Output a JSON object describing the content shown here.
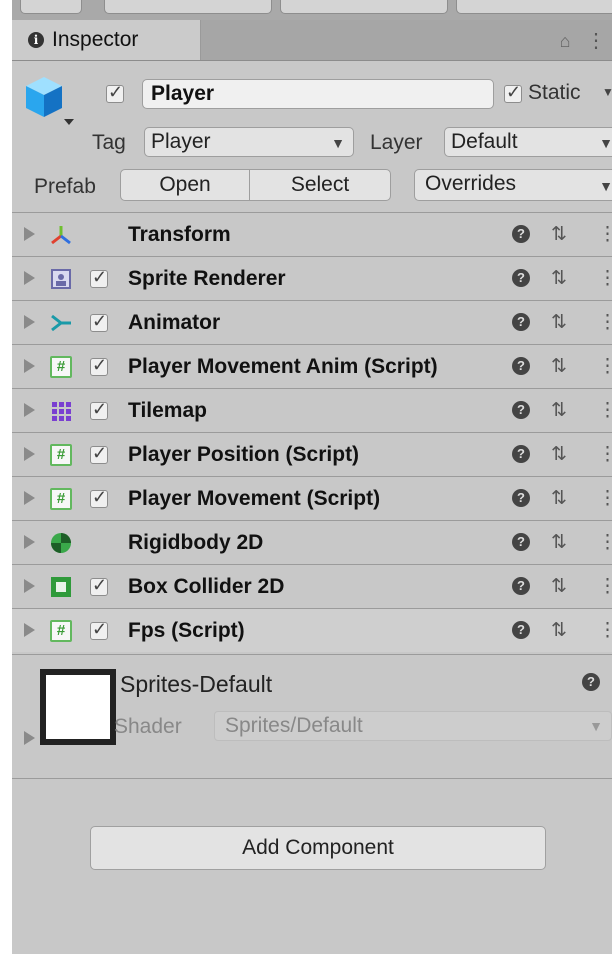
{
  "inspector": {
    "tab_title": "Inspector",
    "tab_info_glyph": "i",
    "lock_glyph": "🔒",
    "menu_glyph": "⋮"
  },
  "gameobject": {
    "name": "Player",
    "active": true,
    "static_label": "Static",
    "static_checked": true,
    "tag_label": "Tag",
    "tag_value": "Player",
    "layer_label": "Layer",
    "layer_value": "Default",
    "prefab_label": "Prefab",
    "prefab_open": "Open",
    "prefab_select": "Select",
    "prefab_overrides": "Overrides"
  },
  "components": [
    {
      "name": "Transform",
      "icon": "transform-icon",
      "has_checkbox": false
    },
    {
      "name": "Sprite Renderer",
      "icon": "sprite-renderer-icon",
      "has_checkbox": true
    },
    {
      "name": "Animator",
      "icon": "animator-icon",
      "has_checkbox": true
    },
    {
      "name": "Player Movement Anim (Script)",
      "icon": "script-icon",
      "has_checkbox": true
    },
    {
      "name": "Tilemap",
      "icon": "tilemap-icon",
      "has_checkbox": true
    },
    {
      "name": "Player Position (Script)",
      "icon": "script-icon",
      "has_checkbox": true
    },
    {
      "name": "Player Movement (Script)",
      "icon": "script-icon",
      "has_checkbox": true
    },
    {
      "name": "Rigidbody 2D",
      "icon": "rigidbody2d-icon",
      "has_checkbox": false
    },
    {
      "name": "Box Collider 2D",
      "icon": "boxcollider2d-icon",
      "has_checkbox": true
    },
    {
      "name": "Fps (Script)",
      "icon": "script-icon",
      "has_checkbox": true
    }
  ],
  "material": {
    "name": "Sprites-Default",
    "shader_label": "Shader",
    "shader_value": "Sprites/Default"
  },
  "add_component_label": "Add Component",
  "colors": {
    "panel_bg": "#c8c8c8",
    "script_green": "#62b85e",
    "tilemap_purple": "#7a3fd1",
    "transform_red": "#e0412f"
  }
}
